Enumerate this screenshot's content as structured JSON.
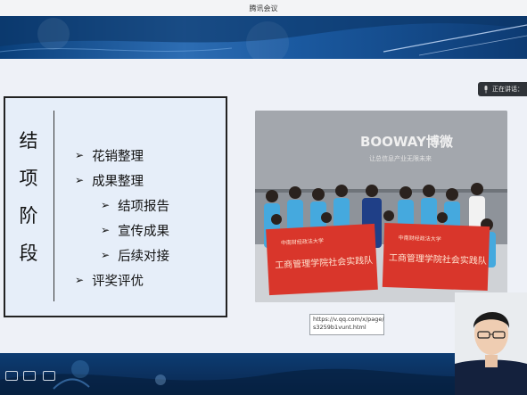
{
  "window": {
    "title": "腾讯会议"
  },
  "slide": {
    "section_title_chars": [
      "结",
      "项",
      "阶",
      "段"
    ],
    "items": [
      {
        "label": "花销整理",
        "level": 0
      },
      {
        "label": "成果整理",
        "level": 0
      },
      {
        "label": "结项报告",
        "level": 1
      },
      {
        "label": "宣传成果",
        "level": 1
      },
      {
        "label": "后续对接",
        "level": 1
      },
      {
        "label": "评奖评优",
        "level": 0
      }
    ],
    "photo": {
      "company_sign": "BOOWAY博微",
      "slogan": "让总信息产业无限未来",
      "banner_left": "工商管理学院社会实践队",
      "banner_right": "工商管理学院社会实践队",
      "banner_left_top": "中南财经政法大学",
      "banner_right_top": "中南财经政法大学"
    }
  },
  "link_tooltip": {
    "line1": "https://v.qq.com/x/page/",
    "line2": "s3259b1vunt.html"
  },
  "speaker": {
    "label": "正在讲话："
  },
  "colors": {
    "accent_red": "#d9362b",
    "banner_blue": "#0d3b73",
    "shirt_blue": "#45a9de"
  }
}
